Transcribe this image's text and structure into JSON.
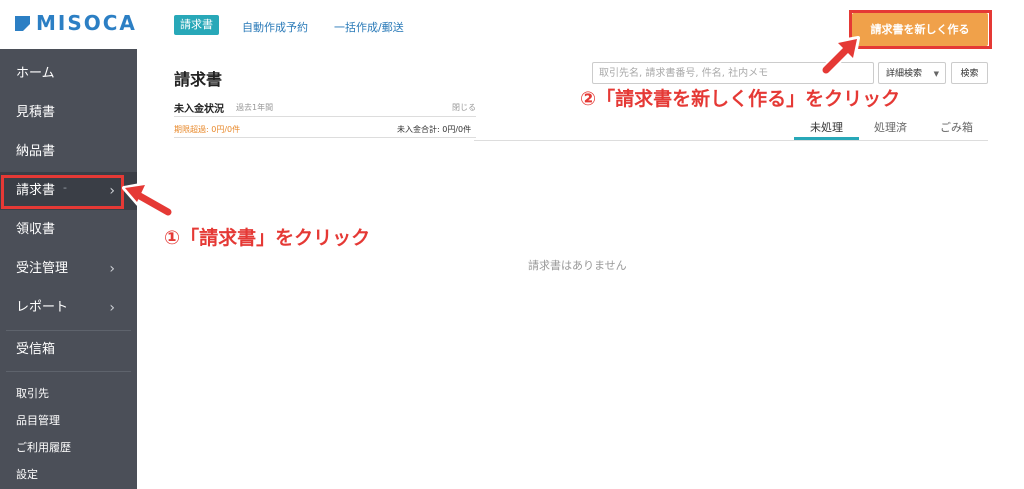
{
  "brand": {
    "logo_text": "MISOCA",
    "color": "#2c7fc4"
  },
  "sidebar": {
    "items": [
      {
        "label": "ホーム",
        "chevron": ""
      },
      {
        "label": "見積書",
        "chevron": ""
      },
      {
        "label": "納品書",
        "chevron": ""
      },
      {
        "label": "請求書",
        "chevron": "›",
        "extra": "-"
      },
      {
        "label": "領収書",
        "chevron": ""
      },
      {
        "label": "受注管理",
        "chevron": "›"
      },
      {
        "label": "レポート",
        "chevron": "›"
      },
      {
        "label": "受信箱",
        "chevron": ""
      }
    ],
    "small_items": [
      "取引先",
      "品目管理",
      "ご利用履歴",
      "設定"
    ]
  },
  "top_tabs": [
    "請求書",
    "自動作成予約",
    "一括作成/郵送"
  ],
  "new_button": "請求書を新しく作る",
  "page_title": "請求書",
  "search": {
    "placeholder": "取引先名, 請求書番号, 件名, 社内メモ",
    "advanced": "詳細検索",
    "button": "検索"
  },
  "unpaid": {
    "title": "未入金状況",
    "period": "過去1年間",
    "close": "閉じる",
    "overdue": "期限超過: 0円/0件",
    "total": "未入金合計: 0円/0件"
  },
  "status_tabs": [
    "未処理",
    "処理済",
    "ごみ箱"
  ],
  "empty_message": "請求書はありません",
  "annotations": {
    "step1": "①「請求書」をクリック",
    "step2": "②「請求書を新しく作る」をクリック"
  },
  "colors": {
    "accent": "#28a8b8",
    "cta": "#f0a14a",
    "annotation": "#e53935",
    "sidebar": "#4b4f58"
  }
}
